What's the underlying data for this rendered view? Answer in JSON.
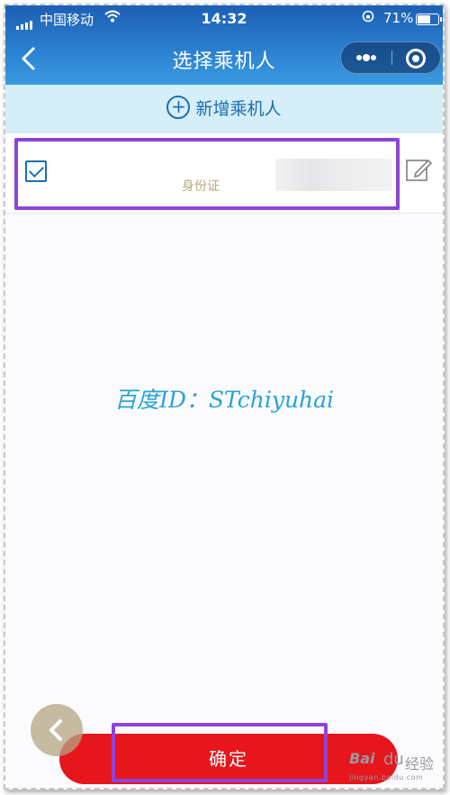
{
  "status_bar": {
    "carrier": "中国移动",
    "time": "14:32",
    "battery_percent": "71%",
    "battery_level": 0.71
  },
  "nav": {
    "title": "选择乘机人",
    "back_icon": "back-chevron-icon",
    "more_icon": "more-dots-icon",
    "close_icon": "miniprogram-close-icon"
  },
  "add_passenger": {
    "label": "新增乘机人",
    "icon": "plus-circle-icon"
  },
  "passengers": [
    {
      "checked": true,
      "id_type": "身份证",
      "edit_icon": "edit-icon"
    }
  ],
  "watermark": "百度ID：STchiyuhai",
  "confirm_label": "确定",
  "float_back_icon": "chevron-left-icon",
  "brand": {
    "mark": "Bai",
    "paw": "du",
    "text": "经验",
    "url": "jingyan.baidu.com"
  },
  "colors": {
    "header": "#2a7fd0",
    "accent_blue": "#1a6fb5",
    "confirm_red": "#e6161c",
    "highlight_purple": "#8f43d8",
    "id_text": "#b9a878"
  }
}
